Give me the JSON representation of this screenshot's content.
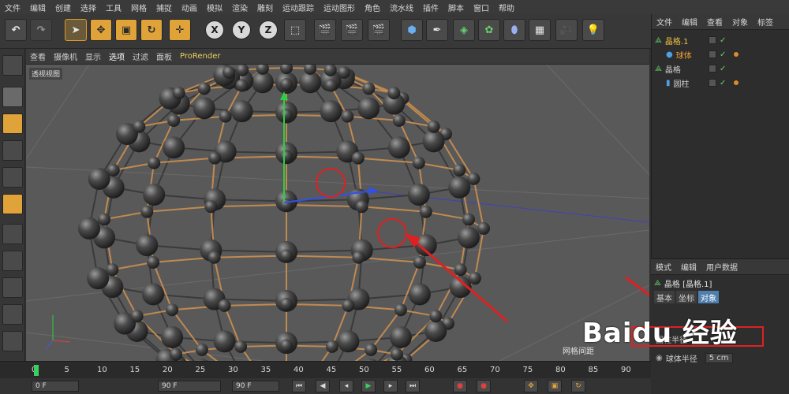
{
  "menu": [
    "文件",
    "编辑",
    "创建",
    "选择",
    "工具",
    "网格",
    "捕捉",
    "动画",
    "模拟",
    "渲染",
    "雕刻",
    "运动跟踪",
    "运动图形",
    "角色",
    "流水线",
    "插件",
    "脚本",
    "窗口",
    "帮助"
  ],
  "toolbar": {
    "axis_labels": [
      "X",
      "Y",
      "Z"
    ]
  },
  "viewport": {
    "menu": [
      "查看",
      "摄像机",
      "显示",
      "选项",
      "过滤",
      "面板",
      "ProRender"
    ],
    "label": "透视视图",
    "grid_label": "网格间距"
  },
  "object_manager": {
    "menu": [
      "文件",
      "编辑",
      "查看",
      "对象",
      "标签"
    ],
    "rows": [
      {
        "name": "晶格.1",
        "selected": false
      },
      {
        "name": "球体",
        "selected": true
      },
      {
        "name": "晶格",
        "selected": false
      },
      {
        "name": "圆柱",
        "selected": false
      }
    ]
  },
  "attributes": {
    "menu": [
      "模式",
      "编辑",
      "用户数据"
    ],
    "title": "晶格 [晶格.1]",
    "tabs": [
      "基本",
      "坐标",
      "对象"
    ],
    "active_tab": "对象",
    "cylinder_radius_label": "圆柱半径",
    "cylinder_radius_value": "",
    "sphere_radius_label": "球体半径",
    "sphere_radius_value": "5 cm"
  },
  "timeline": {
    "ticks": [
      "0",
      "5",
      "10",
      "15",
      "20",
      "25",
      "30",
      "35",
      "40",
      "45",
      "50",
      "55",
      "60",
      "65",
      "70",
      "75",
      "80",
      "85",
      "90"
    ],
    "current_frame": 0
  },
  "transport": {
    "start_field": "0 F",
    "end_field": "90 F",
    "preview_end": "90 F"
  },
  "watermark": "Baidu 经验",
  "colors": {
    "accent": "#e0a33a",
    "selection": "#f0a030",
    "highlight_red": "#e02020",
    "timeline_marker": "#3ad060"
  }
}
